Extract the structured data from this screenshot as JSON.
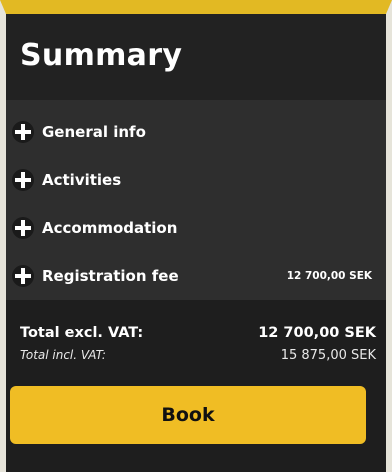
{
  "summary": {
    "title": "Summary",
    "items": [
      {
        "label": "General info",
        "value": "",
        "icon": "plus-icon"
      },
      {
        "label": "Activities",
        "value": "",
        "icon": "plus-icon"
      },
      {
        "label": "Accommodation",
        "value": "",
        "icon": "plus-icon"
      },
      {
        "label": "Registration fee",
        "value": "12 700,00 SEK",
        "icon": "plus-icon"
      }
    ],
    "totals": {
      "excl_label": "Total excl. VAT:",
      "excl_value": "12 700,00 SEK",
      "incl_label": "Total incl. VAT:",
      "incl_value": "15 875,00 SEK"
    },
    "book_label": "Book"
  },
  "colors": {
    "accent": "#f0bd24",
    "panel": "#2e2e2e",
    "header": "#222222"
  }
}
